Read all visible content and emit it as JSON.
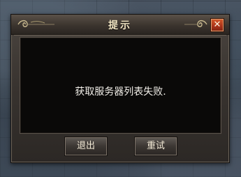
{
  "dialog": {
    "title": "提示",
    "message": "获取服务器列表失败.",
    "close_label": "✕",
    "buttons": {
      "exit_label": "退出",
      "retry_label": "重试"
    }
  },
  "colors": {
    "title_text": "#f2e6c4",
    "close_button": "#c0421f",
    "message_panel": "#0a0908",
    "frame": "#3b342e"
  },
  "icons": {
    "left_ornament": "scroll-ornament-icon",
    "right_ornament": "scroll-ornament-icon",
    "close": "close-icon"
  }
}
